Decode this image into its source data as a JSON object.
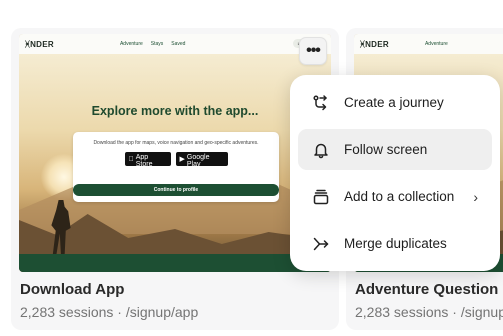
{
  "cards": [
    {
      "site": {
        "logo": "ᚸNDER",
        "nav": [
          "Adventure",
          "Stays",
          "Saved"
        ],
        "login": "Log",
        "hero_title": "Explore more with the app...",
        "app_desc": "Download the app for maps, voice navigation and geo-specific adventures.",
        "app_store_small": "Download on the",
        "app_store_big": "App Store",
        "google_small": "GET IT ON",
        "google_big": "Google Play",
        "continue_label": "Continue to profile"
      },
      "title": "Download App",
      "meta": "2,283 sessions · /signup/app"
    },
    {
      "site": {
        "logo": "ᚸNDER",
        "nav": [
          "Adventure"
        ]
      },
      "title": "Adventure Question",
      "meta": "2,283 sessions · /signup"
    }
  ],
  "kebab": {
    "icon": "more-horizontal-icon",
    "label": "•••"
  },
  "menu": {
    "items": [
      {
        "label": "Create a journey",
        "icon": "route-icon",
        "active": false,
        "submenu": false
      },
      {
        "label": "Follow screen",
        "icon": "bell-icon",
        "active": true,
        "submenu": false
      },
      {
        "label": "Add to a collection",
        "icon": "collection-icon",
        "active": false,
        "submenu": true
      },
      {
        "label": "Merge duplicates",
        "icon": "merge-icon",
        "active": false,
        "submenu": false
      }
    ],
    "chevron": "›"
  },
  "colors": {
    "brand_green": "#1d4f33",
    "menu_active": "#efefef"
  }
}
